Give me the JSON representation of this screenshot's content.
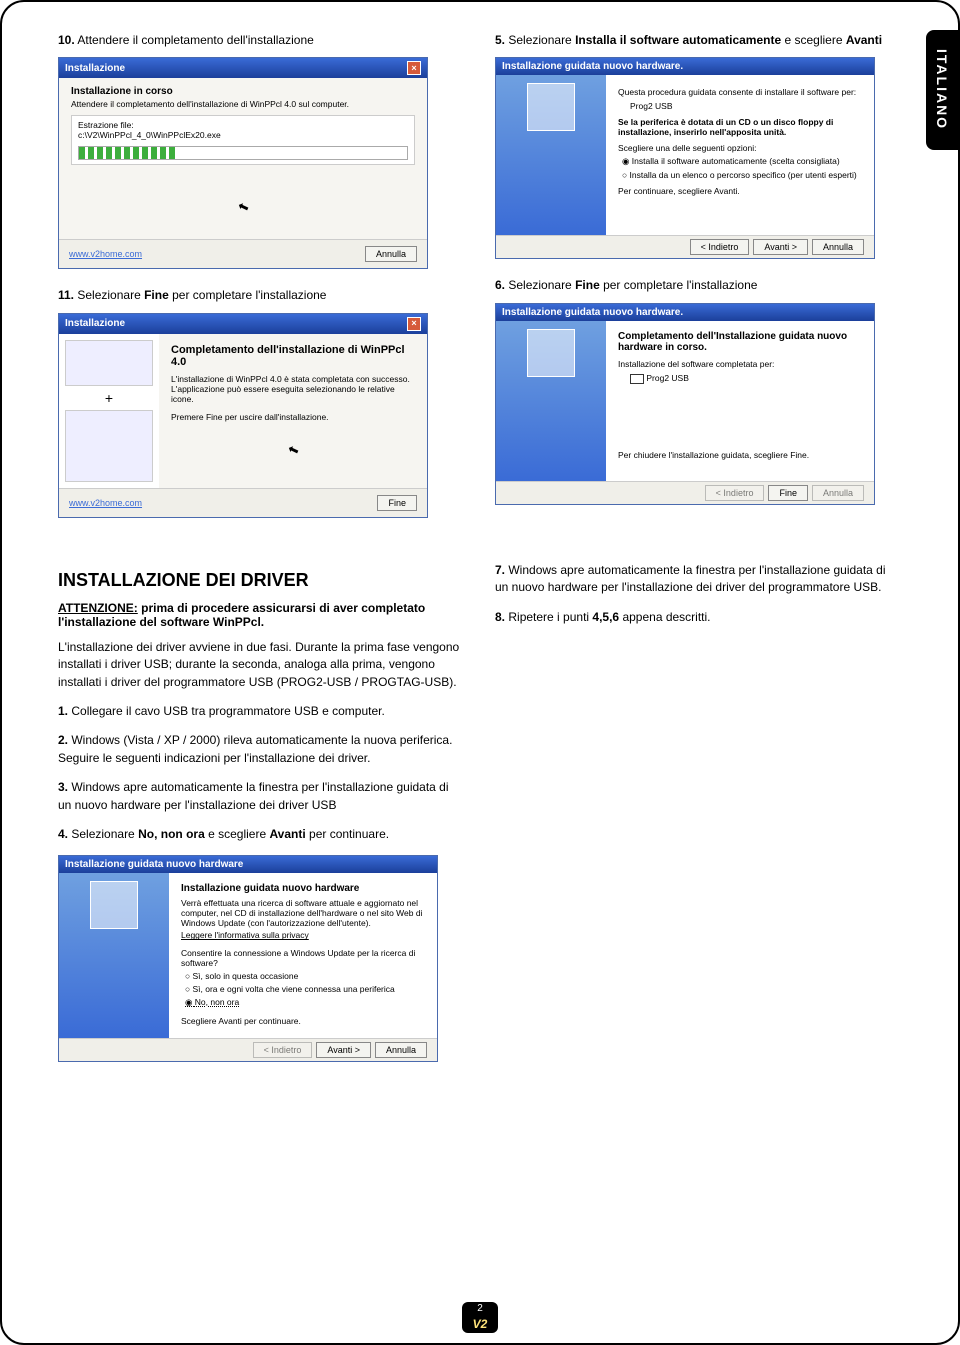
{
  "side_tab": "ITALIANO",
  "page_number": "2",
  "brand_logo": "V2",
  "col_left": {
    "step10": {
      "num": "10.",
      "text": "Attendere il completamento dell'installazione"
    },
    "step11": {
      "num": "11.",
      "text_a": "Selezionare ",
      "bold": "Fine",
      "text_b": " per completare l'installazione"
    }
  },
  "col_right": {
    "step5": {
      "num": "5.",
      "text_a": "Selezionare ",
      "bold1": "Installa il software automaticamente",
      "text_b": " e scegliere ",
      "bold2": "Avanti"
    },
    "step6": {
      "num": "6.",
      "text_a": "Selezionare ",
      "bold": "Fine",
      "text_b": " per completare l'installazione"
    }
  },
  "win_progress": {
    "title": "Installazione",
    "subtitle": "Installazione in corso",
    "desc": "Attendere il completamento dell'installazione di WinPPcl 4.0 sul computer.",
    "ex_label": "Estrazione file:",
    "ex_path": "c:\\V2\\WinPPcl_4_0\\WinPPclEx20.exe",
    "link": "www.v2home.com",
    "btn_cancel": "Annulla"
  },
  "win_finish": {
    "title": "Installazione",
    "headline": "Completamento dell'installazione di WinPPcl 4.0",
    "line1": "L'installazione di WinPPcl 4.0 è stata completata con successo. L'applicazione può essere eseguita selezionando le relative icone.",
    "line2": "Premere Fine per uscire dall'installazione.",
    "link": "www.v2home.com",
    "btn_finish": "Fine"
  },
  "win_hw1": {
    "title": "Installazione guidata nuovo hardware.",
    "desc": "Questa procedura guidata consente di installare il software per:",
    "device": "Prog2 USB",
    "cd_hint": "Se la periferica è dotata di un CD o un disco floppy di installazione, inserirlo nell'apposita unità.",
    "choose": "Scegliere una delle seguenti opzioni:",
    "opt1": "Installa il software automaticamente (scelta consigliata)",
    "opt2": "Installa da un elenco o percorso specifico (per utenti esperti)",
    "cont": "Per continuare, scegliere Avanti.",
    "btn_back": "< Indietro",
    "btn_next": "Avanti >",
    "btn_cancel": "Annulla"
  },
  "win_hw2": {
    "title": "Installazione guidata nuovo hardware.",
    "headline": "Completamento dell'Installazione guidata nuovo hardware in corso.",
    "done_for": "Installazione del software completata per:",
    "device": "Prog2 USB",
    "close_hint": "Per chiudere l'installazione guidata, scegliere Fine.",
    "btn_back": "< Indietro",
    "btn_finish": "Fine",
    "btn_cancel": "Annulla"
  },
  "win_hw3": {
    "title": "Installazione guidata nuovo hardware",
    "headline": "Installazione guidata nuovo hardware",
    "desc": "Verrà effettuata una ricerca di software attuale e aggiornato nel computer, nel CD di installazione dell'hardware o nel sito Web di Windows Update (con l'autorizzazione dell'utente).",
    "privacy": "Leggere l'informativa sulla privacy",
    "question": "Consentire la connessione a Windows Update per la ricerca di software?",
    "opt1": "Sì, solo in questa occasione",
    "opt2": "Sì, ora e ogni volta che viene connessa una periferica",
    "opt3": "No, non ora",
    "cont": "Scegliere Avanti per continuare.",
    "btn_back": "< Indietro",
    "btn_next": "Avanti >",
    "btn_cancel": "Annulla"
  },
  "drivers_section": {
    "heading": "INSTALLAZIONE DEI DRIVER",
    "warning_label": "ATTENZIONE:",
    "warning_rest": " prima di procedere assicurarsi di aver completato l'installazione del software WinPPcl.",
    "intro": "L'installazione dei driver avviene in due fasi. Durante la prima fase vengono installati i driver USB; durante la seconda, analoga alla prima, vengono installati i driver del programmatore USB (PROG2-USB / PROGTAG-USB).",
    "s1": {
      "num": "1.",
      "text": "Collegare il cavo USB tra programmatore USB e computer."
    },
    "s2": {
      "num": "2.",
      "text": "Windows (Vista / XP / 2000) rileva automaticamente la nuova periferica. Seguire le seguenti indicazioni per l'installazione dei driver."
    },
    "s3": {
      "num": "3.",
      "text": "Windows apre automaticamente la finestra per l'installazione guidata di un nuovo hardware per l'installazione dei driver USB"
    },
    "s4": {
      "num": "4.",
      "text_a": "Selezionare ",
      "bold1": "No, non ora",
      "text_b": " e scegliere ",
      "bold2": "Avanti",
      "text_c": " per continuare."
    },
    "s7": {
      "num": "7.",
      "text": "Windows apre automaticamente la finestra per l'installazione guidata di un nuovo hardware per l'installazione dei driver del programmatore USB."
    },
    "s8": {
      "num": "8.",
      "text_a": "Ripetere i punti ",
      "bold": "4,5,6",
      "text_b": " appena descritti."
    }
  }
}
